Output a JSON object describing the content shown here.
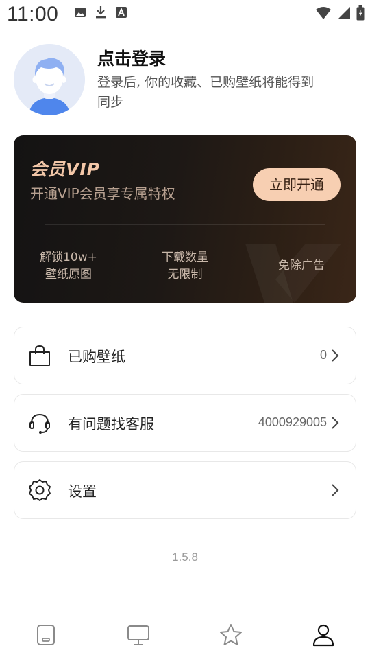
{
  "status_bar": {
    "time": "11:00",
    "left_icons": [
      "image-icon",
      "download-icon",
      "font-a-icon"
    ],
    "right_icons": [
      "wifi-icon",
      "signal-icon",
      "battery-icon"
    ]
  },
  "profile": {
    "title": "点击登录",
    "subtitle": "登录后, 你的收藏、已购壁纸将能得到同步"
  },
  "vip_card": {
    "title": "会员VIP",
    "subtitle": "开通VIP会员享专属特权",
    "button_label": "立即开通",
    "perks": [
      {
        "line1": "解锁10w+",
        "line2": "壁纸原图"
      },
      {
        "line1": "下载数量",
        "line2": "无限制"
      },
      {
        "line1": "免除广告",
        "line2": ""
      }
    ],
    "colors": {
      "accent": "#f7cfb2",
      "title": "#f3c7a8"
    }
  },
  "menu": {
    "purchased": {
      "label": "已购壁纸",
      "value": "0",
      "icon": "shopping-bag-icon"
    },
    "support": {
      "label": "有问题找客服",
      "value": "4000929005",
      "icon": "headset-icon"
    },
    "settings": {
      "label": "设置",
      "value": "",
      "icon": "gear-icon"
    }
  },
  "version": "1.5.8",
  "bottom_nav": {
    "items": [
      "phone-wallpaper-icon",
      "desktop-monitor-icon",
      "star-icon",
      "user-profile-icon"
    ],
    "active": "user-profile-icon"
  }
}
